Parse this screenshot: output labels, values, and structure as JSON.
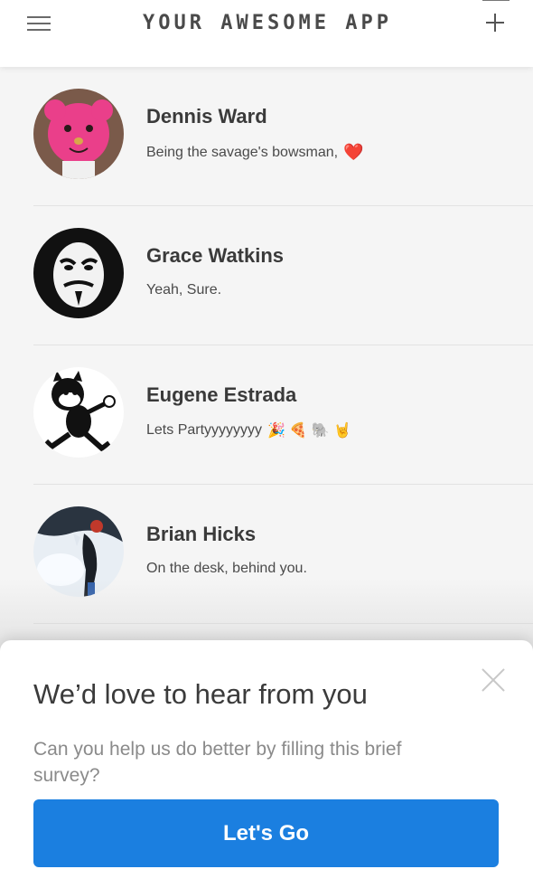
{
  "header": {
    "title": "YOUR AWESOME APP",
    "menu_icon": "hamburger-menu-icon",
    "add_icon": "plus-icon"
  },
  "chats": [
    {
      "name": "Dennis Ward",
      "message": "Being the savage's bowsman,",
      "emoji": "❤️",
      "avatar": "pink-bear-avatar"
    },
    {
      "name": "Grace Watkins",
      "message": "Yeah, Sure.",
      "emoji": "",
      "avatar": "anonymous-mask-avatar"
    },
    {
      "name": "Eugene Estrada",
      "message": "Lets Partyyyyyyyy",
      "emoji": "🎉 🍕 🐘 🤘",
      "avatar": "cartoon-cat-avatar"
    },
    {
      "name": "Brian Hicks",
      "message": "On the desk, behind you.",
      "emoji": "",
      "avatar": "snow-photo-avatar"
    }
  ],
  "survey": {
    "title": "We’d love to hear from you",
    "text": "Can you help us do better by filling this brief survey?",
    "button_label": "Let's Go"
  },
  "colors": {
    "primary": "#1b7fe0",
    "background": "#f5f5f5",
    "heart": "#e02430"
  }
}
